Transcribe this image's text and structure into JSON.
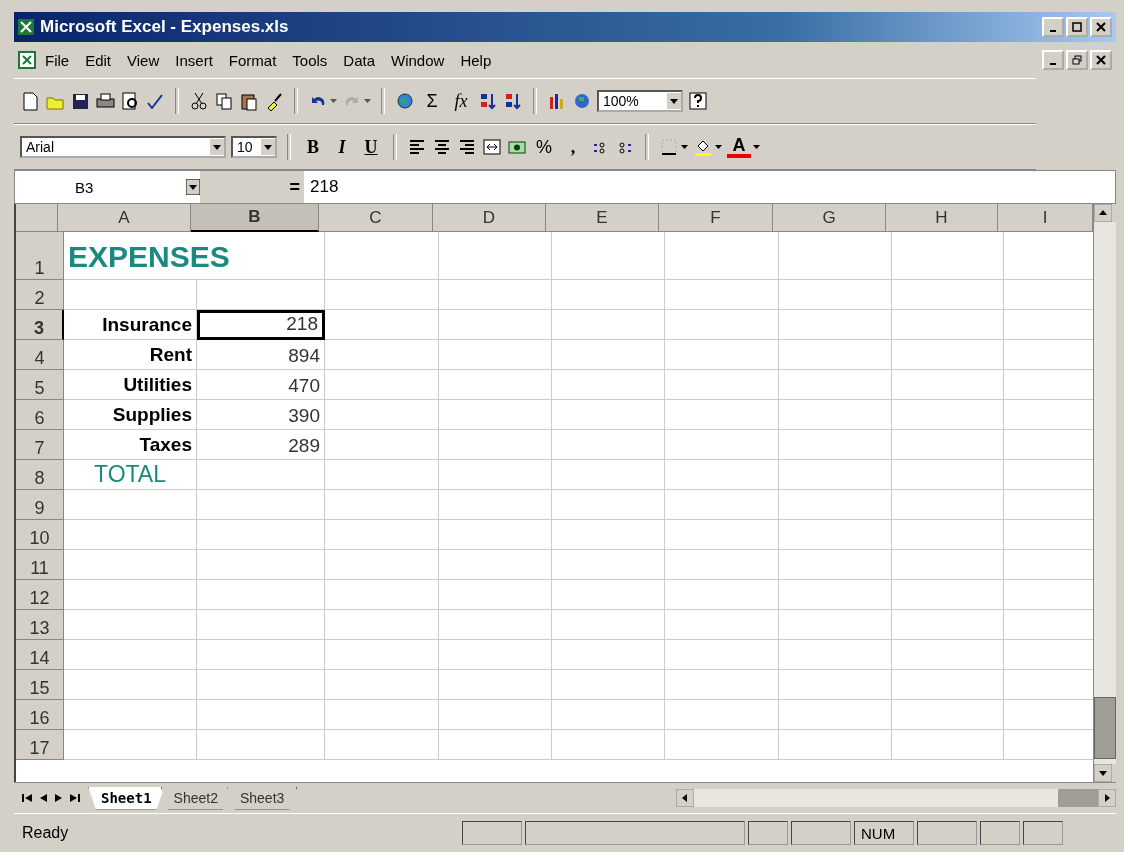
{
  "window": {
    "title": "Microsoft Excel - Expenses.xls"
  },
  "menu": [
    "File",
    "Edit",
    "View",
    "Insert",
    "Format",
    "Tools",
    "Data",
    "Window",
    "Help"
  ],
  "standard_toolbar": {
    "sum_glyph": "Σ",
    "function_glyph": "fx",
    "zoom": "100%"
  },
  "formatting_toolbar": {
    "font": "Arial",
    "size": "10",
    "bold": "B",
    "italic": "I",
    "underline": "U",
    "percent": "%",
    "comma": ",",
    "font_color_glyph": "A"
  },
  "formula_bar": {
    "name_box": "B3",
    "equals": "=",
    "content": "218"
  },
  "columns": [
    {
      "label": "A",
      "selected": false
    },
    {
      "label": "B",
      "selected": true
    },
    {
      "label": "C",
      "selected": false
    },
    {
      "label": "D",
      "selected": false
    },
    {
      "label": "E",
      "selected": false
    },
    {
      "label": "F",
      "selected": false
    },
    {
      "label": "G",
      "selected": false
    },
    {
      "label": "H",
      "selected": false
    },
    {
      "label": "I",
      "selected": false
    }
  ],
  "rows": [
    {
      "number": "1",
      "selected": false,
      "a": {
        "text": "EXPENSES",
        "kind": "title"
      }
    },
    {
      "number": "2",
      "selected": false
    },
    {
      "number": "3",
      "selected": true,
      "a": {
        "text": "Insurance",
        "kind": "label"
      },
      "b": {
        "text": "218",
        "kind": "value",
        "selected": true
      }
    },
    {
      "number": "4",
      "selected": false,
      "a": {
        "text": "Rent",
        "kind": "label"
      },
      "b": {
        "text": "894",
        "kind": "value",
        "selected": false
      }
    },
    {
      "number": "5",
      "selected": false,
      "a": {
        "text": "Utilities",
        "kind": "label"
      },
      "b": {
        "text": "470",
        "kind": "value",
        "selected": false
      }
    },
    {
      "number": "6",
      "selected": false,
      "a": {
        "text": "Supplies",
        "kind": "label"
      },
      "b": {
        "text": "390",
        "kind": "value",
        "selected": false
      }
    },
    {
      "number": "7",
      "selected": false,
      "a": {
        "text": "Taxes",
        "kind": "label"
      },
      "b": {
        "text": "289",
        "kind": "value",
        "selected": false
      }
    },
    {
      "number": "8",
      "selected": false,
      "a": {
        "text": "TOTAL",
        "kind": "total"
      }
    },
    {
      "number": "9",
      "selected": false
    },
    {
      "number": "10",
      "selected": false
    },
    {
      "number": "11",
      "selected": false
    },
    {
      "number": "12",
      "selected": false
    },
    {
      "number": "13",
      "selected": false
    },
    {
      "number": "14",
      "selected": false
    },
    {
      "number": "15",
      "selected": false
    },
    {
      "number": "16",
      "selected": false
    },
    {
      "number": "17",
      "selected": false
    }
  ],
  "sheet_tabs": [
    {
      "label": "Sheet1",
      "selected": true
    },
    {
      "label": "Sheet2",
      "selected": false
    },
    {
      "label": "Sheet3",
      "selected": false
    }
  ],
  "status_bar": {
    "message": "Ready",
    "indicator": "NUM"
  }
}
